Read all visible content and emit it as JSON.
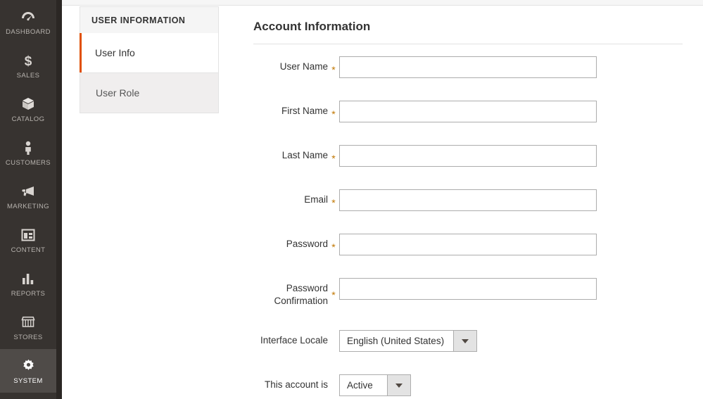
{
  "colors": {
    "nav_bg": "#373330",
    "nav_active_bg": "#4f4b48",
    "accent_orange": "#e04f00",
    "required_marker": "#c07600",
    "panel_bg": "#f0eeee",
    "border": "#e3e3e3"
  },
  "admin_nav": {
    "items": [
      {
        "label": "DASHBOARD",
        "icon": "dashboard-gauge-icon",
        "active": false
      },
      {
        "label": "SALES",
        "icon": "dollar-sign-icon",
        "active": false
      },
      {
        "label": "CATALOG",
        "icon": "box-icon",
        "active": false
      },
      {
        "label": "CUSTOMERS",
        "icon": "person-icon",
        "active": false
      },
      {
        "label": "MARKETING",
        "icon": "megaphone-icon",
        "active": false
      },
      {
        "label": "CONTENT",
        "icon": "layout-page-icon",
        "active": false
      },
      {
        "label": "REPORTS",
        "icon": "bar-chart-icon",
        "active": false
      },
      {
        "label": "STORES",
        "icon": "storefront-icon",
        "active": false
      },
      {
        "label": "SYSTEM",
        "icon": "gear-icon",
        "active": true
      }
    ]
  },
  "tabs_panel": {
    "title": "USER INFORMATION",
    "tabs": [
      {
        "label": "User Info",
        "active": true
      },
      {
        "label": "User Role",
        "active": false
      }
    ]
  },
  "form": {
    "section_title": "Account Information",
    "fields": [
      {
        "label": "User Name",
        "required": true,
        "type": "text",
        "value": "",
        "placeholder": ""
      },
      {
        "label": "First Name",
        "required": true,
        "type": "text",
        "value": "",
        "placeholder": ""
      },
      {
        "label": "Last Name",
        "required": true,
        "type": "text",
        "value": "",
        "placeholder": ""
      },
      {
        "label": "Email",
        "required": true,
        "type": "text",
        "value": "",
        "placeholder": ""
      },
      {
        "label": "Password",
        "required": true,
        "type": "text",
        "value": "",
        "placeholder": ""
      },
      {
        "label": "Password Confirmation",
        "required": true,
        "type": "text",
        "value": "",
        "placeholder": ""
      },
      {
        "label": "Interface Locale",
        "required": false,
        "type": "select",
        "value": "English (United States)"
      },
      {
        "label": "This account is",
        "required": false,
        "type": "select",
        "value": "Active"
      }
    ],
    "required_marker": "*"
  }
}
